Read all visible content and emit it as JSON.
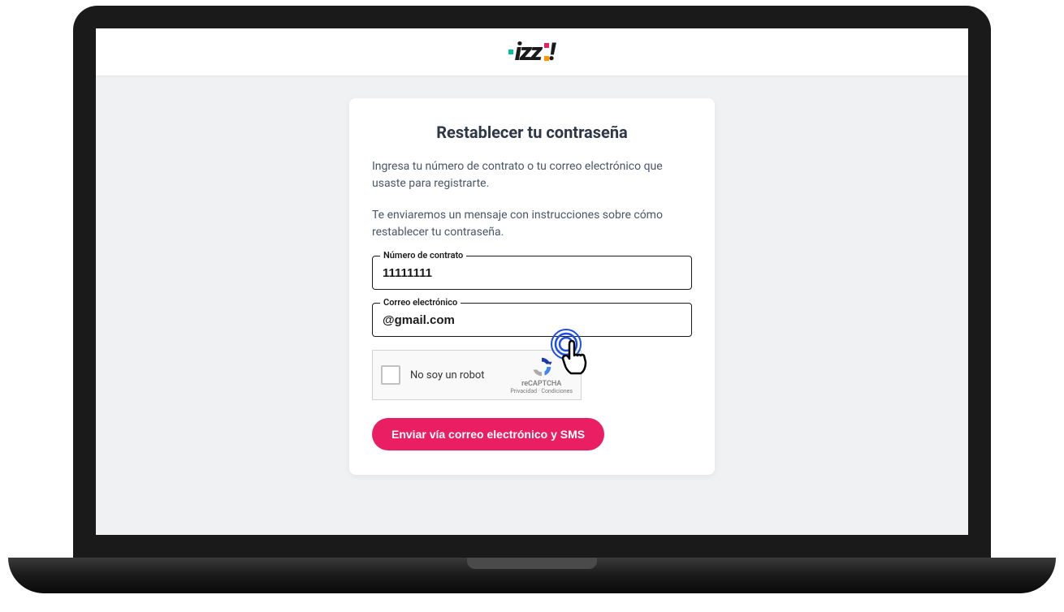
{
  "logo": {
    "text": "izz"
  },
  "card": {
    "title": "Restablecer tu contraseña",
    "instruction1": "Ingresa tu número de contrato o tu correo electrónico que usaste para registrarte.",
    "instruction2": "Te enviaremos un mensaje con instrucciones sobre cómo restablecer tu contraseña."
  },
  "fields": {
    "contract": {
      "label": "Número de contrato",
      "value": "11111111"
    },
    "email": {
      "label": "Correo electrónico",
      "value": "@gmail.com"
    }
  },
  "recaptcha": {
    "text": "No soy un robot",
    "brand": "reCAPTCHA",
    "terms": "Privacidad · Condiciones"
  },
  "button": {
    "submit": "Enviar vía correo electrónico y SMS"
  }
}
